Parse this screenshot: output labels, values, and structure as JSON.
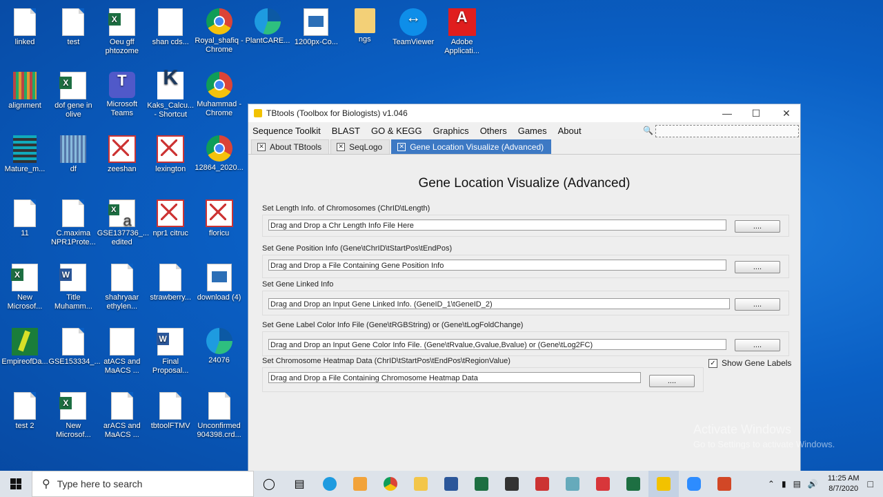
{
  "desktop_icons": [
    {
      "label": "linked",
      "type": "doc"
    },
    {
      "label": "test",
      "type": "doc"
    },
    {
      "label": "Oeu gff phtozome",
      "type": "excel"
    },
    {
      "label": "shan cds...",
      "type": "chart"
    },
    {
      "label": "Royal_shafiq - Chrome",
      "type": "chrome"
    },
    {
      "label": "PlantCARE...",
      "type": "edge"
    },
    {
      "label": "1200px-Co...",
      "type": "image"
    },
    {
      "label": "ngs",
      "type": "folder"
    },
    {
      "label": "TeamViewer",
      "type": "teamviewer"
    },
    {
      "label": "Adobe Applicati...",
      "type": "adobe"
    },
    {
      "label": "alignment",
      "type": "barcode"
    },
    {
      "label": "dof gene in olive",
      "type": "excel"
    },
    {
      "label": "Microsoft Teams",
      "type": "teams"
    },
    {
      "label": "Kaks_Calcu... - Shortcut",
      "type": "kaks"
    },
    {
      "label": "Muhammad - Chrome",
      "type": "chrome"
    },
    {
      "label": "Mature_m...",
      "type": "mature"
    },
    {
      "label": "df",
      "type": "df"
    },
    {
      "label": "zeeshan",
      "type": "slide"
    },
    {
      "label": "lexington",
      "type": "slide"
    },
    {
      "label": "12864_2020...",
      "type": "chrome"
    },
    {
      "label": "11",
      "type": "doc"
    },
    {
      "label": "C.maxima NPR1Prote...",
      "type": "doc"
    },
    {
      "label": "GSE137736_... edited",
      "type": "amazon"
    },
    {
      "label": "npr1 citruc",
      "type": "slide"
    },
    {
      "label": "floricu",
      "type": "slide"
    },
    {
      "label": "New Microsof...",
      "type": "excel"
    },
    {
      "label": "Title Muhamm...",
      "type": "word"
    },
    {
      "label": "shahryaar ethylen...",
      "type": "doc"
    },
    {
      "label": "strawberry...",
      "type": "doc"
    },
    {
      "label": "download (4)",
      "type": "image"
    },
    {
      "label": "EmpireofDa...",
      "type": "green"
    },
    {
      "label": "GSE153334_...",
      "type": "doc"
    },
    {
      "label": "atACS and MaACS ...",
      "type": "chart"
    },
    {
      "label": "Final Proposal...",
      "type": "word"
    },
    {
      "label": "24076",
      "type": "edge"
    },
    {
      "label": "test 2",
      "type": "doc"
    },
    {
      "label": "New Microsof...",
      "type": "excel"
    },
    {
      "label": "arACS and MaACS ...",
      "type": "doc"
    },
    {
      "label": "tbtoolFTMV",
      "type": "doc"
    },
    {
      "label": "Unconfirmed 904398.crd...",
      "type": "doc"
    }
  ],
  "window": {
    "title": "TBtools (Toolbox for Biologists) v1.046",
    "minimize": "—",
    "maximize": "☐",
    "close": "✕"
  },
  "menu": [
    "Sequence Toolkit",
    "BLAST",
    "GO & KEGG",
    "Graphics",
    "Others",
    "Games",
    "About"
  ],
  "tabs": [
    {
      "label": "About TBtools",
      "active": false
    },
    {
      "label": "SeqLogo",
      "active": false
    },
    {
      "label": "Gene Location Visualize (Advanced)",
      "active": true
    }
  ],
  "panel": {
    "title": "Gene Location Visualize (Advanced)",
    "sections": [
      {
        "label": "Set Length Info. of Chromosomes (ChrID\\tLength)",
        "placeholder": "Drag and Drop a Chr Length Info File Here",
        "button": "...."
      },
      {
        "label": "Set Gene Position Info (Gene\\tChrID\\tStartPos\\tEndPos)",
        "placeholder": "Drag and Drop a File Containing Gene Position Info",
        "button": "...."
      },
      {
        "label": "Set Gene Linked Info",
        "placeholder": "Drag and Drop an Input Gene Linked Info. (GeneID_1\\tGeneID_2)",
        "button": "...."
      },
      {
        "label": "Set Gene Label Color Info File (Gene\\tRGBString) or (Gene\\tLogFoldChange)",
        "placeholder": "Drag and Drop an Input Gene Color Info File. (Gene\\tRvalue,Gvalue,Bvalue) or (Gene\\tLog2FC)",
        "button": "...."
      },
      {
        "label": "Set Chromosome Heatmap Data (ChrID\\tStartPos\\tEndPos\\tRegionValue)",
        "placeholder": "Drag and Drop a File Containing Chromosome Heatmap Data",
        "button": "...."
      }
    ],
    "show_gene_labels": {
      "label": "Show Gene Labels",
      "checked": true
    }
  },
  "watermark": {
    "line1": "Activate Windows",
    "line2": "Go to Settings to activate Windows."
  },
  "taskbar": {
    "search_placeholder": "Type here to search",
    "time": "11:25 AM",
    "date": "8/7/2020",
    "accent": "#3d79c4"
  }
}
